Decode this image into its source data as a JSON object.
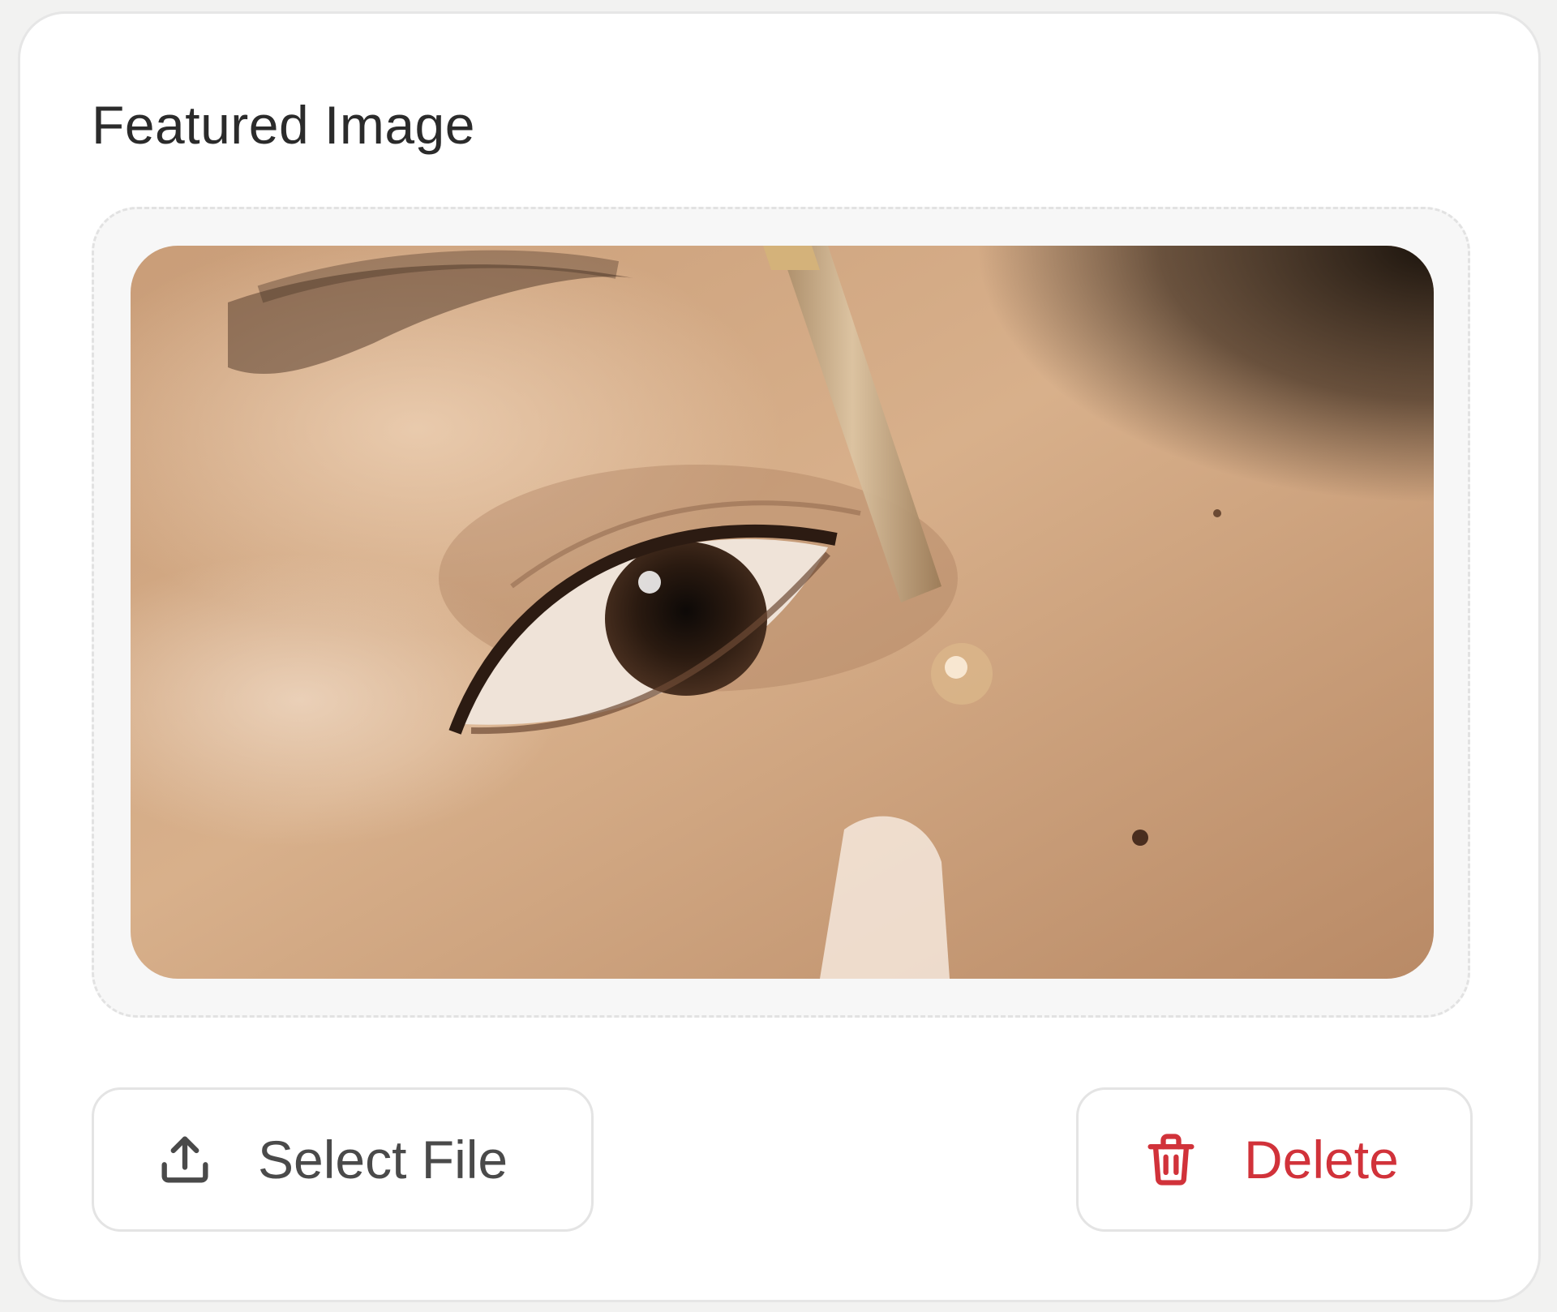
{
  "card": {
    "title": "Featured Image"
  },
  "image": {
    "alt": "Close-up of an eye with a serum dropper"
  },
  "actions": {
    "select_label": "Select File",
    "select_icon": "upload-icon",
    "delete_label": "Delete",
    "delete_icon": "trash-icon"
  },
  "colors": {
    "title_text": "#2b2b2b",
    "select_text": "#4a4a4a",
    "delete_text": "#d1323a",
    "border": "#e4e4e4",
    "dropzone_bg": "#f7f7f7"
  }
}
